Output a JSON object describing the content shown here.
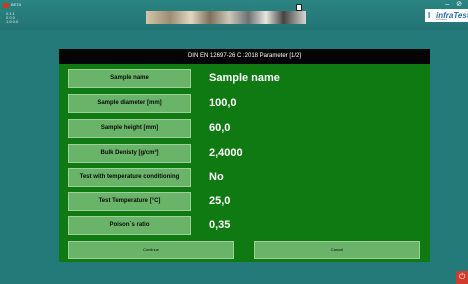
{
  "window": {
    "app_label": "BETA",
    "controls": {
      "minimize": "–",
      "close": "⊘"
    }
  },
  "info_panel": {
    "lines": [
      "0.1.1",
      "0 0 0",
      "1.5 0.0"
    ]
  },
  "logo": {
    "mark": "I",
    "brand": "infraTest",
    "tagline": "prüfsysteme"
  },
  "dialog": {
    "title": "DIN EN 12697-26 C :2018 Parameter [1/2]",
    "params": [
      {
        "label": "Sample name",
        "value": "Sample name"
      },
      {
        "label": "Sample diameter [mm]",
        "value": "100,0"
      },
      {
        "label": "Sample height [mm]",
        "value": "60,0"
      },
      {
        "label": "Bulk Denisty [g/cm³]",
        "value": "2,4000"
      },
      {
        "label": "Test with temperature conditioning",
        "value": "No"
      },
      {
        "label": "Test Temperature [°C]",
        "value": "25,0"
      },
      {
        "label": "Poison´s ratio",
        "value": "0,35"
      }
    ],
    "continue_label": "Continue",
    "cancel_label": "Cancel"
  },
  "colors": {
    "background": "#247a78",
    "dialog": "#0f7a12",
    "field": "#6ab46a",
    "header": "#050505"
  }
}
